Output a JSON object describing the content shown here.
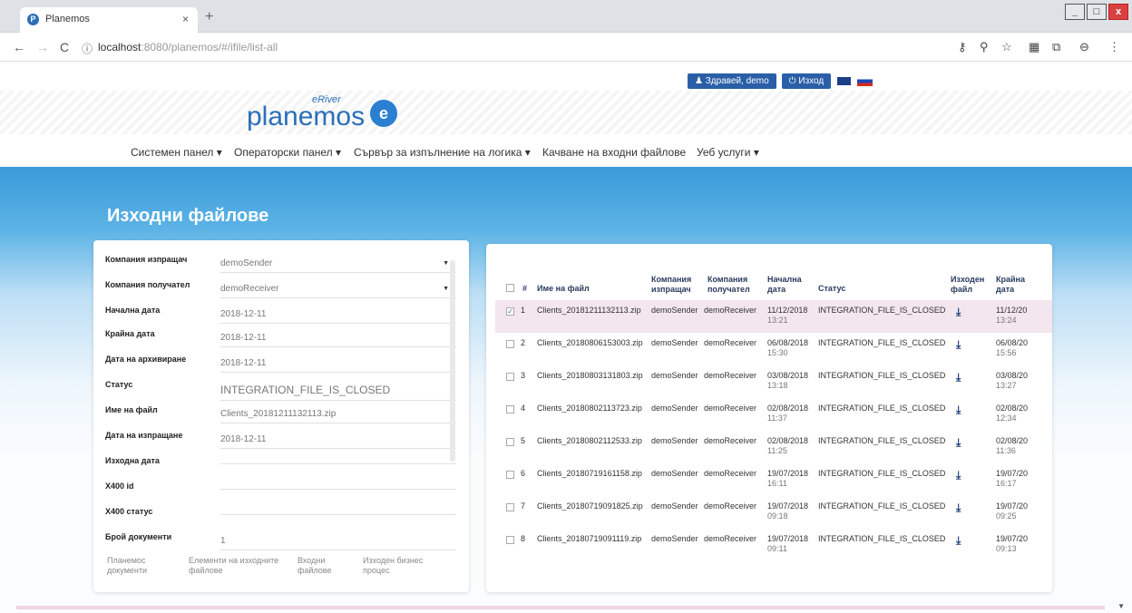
{
  "browser": {
    "tab_title": "Planemos",
    "tab_close": "×",
    "new_tab": "+",
    "favicon": "P",
    "url_host": "localhost",
    "url_rest": ":8080/planemos/#/ifile/list-all",
    "win_min": "_",
    "win_max": "□",
    "win_close": "x",
    "back": "←",
    "forward": "→",
    "reload": "C",
    "info": "ⓘ",
    "key": "⚷",
    "zoom": "⚲",
    "star": "☆",
    "ext": "▦",
    "cast": "⧉",
    "profile": "⊖",
    "more": "⋮"
  },
  "header": {
    "greeting": "Здравей, demo",
    "logout": "Изход",
    "user_glyph": "♟",
    "power_glyph": "⏻"
  },
  "logo": {
    "small": "eRiver",
    "main": "planemos",
    "mark": "e"
  },
  "menu": [
    {
      "label": "Системен панел ▾"
    },
    {
      "label": "Операторски панел ▾"
    },
    {
      "label": "Сървър за изпълнение на логика ▾"
    },
    {
      "label": "Качване на входни файлове"
    },
    {
      "label": "Уеб услуги ▾"
    }
  ],
  "page_title": "Изходни файлове",
  "filters": [
    {
      "label": "Компания изпращач",
      "value": "demoSender"
    },
    {
      "label": "Компания получател",
      "value": "demoReceiver"
    },
    {
      "label": "Начална дата",
      "value": "2018-12-11"
    },
    {
      "label": "Крайна дата",
      "value": "2018-12-11"
    },
    {
      "label": "Дата на архивиране",
      "value": "2018-12-11"
    },
    {
      "label": "Статус",
      "value": "INTEGRATION_FILE_IS_CLOSED"
    },
    {
      "label": "Име на файл",
      "value": "Clients_20181211132113.zip"
    },
    {
      "label": "Дата на изпращане",
      "value": "2018-12-11"
    },
    {
      "label": "Изходна дата",
      "value": ""
    },
    {
      "label": "X400 id",
      "value": ""
    },
    {
      "label": "X400 статус",
      "value": ""
    },
    {
      "label": "Брой документи",
      "value": "1"
    }
  ],
  "left_tabs": [
    {
      "label": "Планемос документи"
    },
    {
      "label": "Елементи на изходните файлове"
    },
    {
      "label": "Входни файлове"
    },
    {
      "label": "Изходен бизнес процес"
    }
  ],
  "table": {
    "headers": {
      "num": "#",
      "name": "Име на файл",
      "sender": "Компания изпращач",
      "receiver": "Компания получател",
      "start": "Начална дата",
      "status": "Статус",
      "outfile": "Изходен файл",
      "end": "Крайна дата"
    },
    "rows": [
      {
        "num": "1",
        "name": "Clients_20181211132113.zip",
        "sender": "demoSender",
        "receiver": "demoReceiver",
        "start_d": "11/12/2018",
        "start_t": "13:21",
        "status": "INTEGRATION_FILE_IS_CLOSED",
        "end_d": "11/12/20",
        "end_t": "13:24",
        "check": "✓"
      },
      {
        "num": "2",
        "name": "Clients_20180806153003.zip",
        "sender": "demoSender",
        "receiver": "demoReceiver",
        "start_d": "06/08/2018",
        "start_t": "15:30",
        "status": "INTEGRATION_FILE_IS_CLOSED",
        "end_d": "06/08/20",
        "end_t": "15:56",
        "check": ""
      },
      {
        "num": "3",
        "name": "Clients_20180803131803.zip",
        "sender": "demoSender",
        "receiver": "demoReceiver",
        "start_d": "03/08/2018",
        "start_t": "13:18",
        "status": "INTEGRATION_FILE_IS_CLOSED",
        "end_d": "03/08/20",
        "end_t": "13:27",
        "check": ""
      },
      {
        "num": "4",
        "name": "Clients_20180802113723.zip",
        "sender": "demoSender",
        "receiver": "demoReceiver",
        "start_d": "02/08/2018",
        "start_t": "11:37",
        "status": "INTEGRATION_FILE_IS_CLOSED",
        "end_d": "02/08/20",
        "end_t": "12:34",
        "check": ""
      },
      {
        "num": "5",
        "name": "Clients_20180802112533.zip",
        "sender": "demoSender",
        "receiver": "demoReceiver",
        "start_d": "02/08/2018",
        "start_t": "11:25",
        "status": "INTEGRATION_FILE_IS_CLOSED",
        "end_d": "02/08/20",
        "end_t": "11:36",
        "check": ""
      },
      {
        "num": "6",
        "name": "Clients_20180719161158.zip",
        "sender": "demoSender",
        "receiver": "demoReceiver",
        "start_d": "19/07/2018",
        "start_t": "16:11",
        "status": "INTEGRATION_FILE_IS_CLOSED",
        "end_d": "19/07/20",
        "end_t": "16:17",
        "check": ""
      },
      {
        "num": "7",
        "name": "Clients_20180719091825.zip",
        "sender": "demoSender",
        "receiver": "demoReceiver",
        "start_d": "19/07/2018",
        "start_t": "09:18",
        "status": "INTEGRATION_FILE_IS_CLOSED",
        "end_d": "19/07/20",
        "end_t": "09:25",
        "check": ""
      },
      {
        "num": "8",
        "name": "Clients_20180719091119.zip",
        "sender": "demoSender",
        "receiver": "demoReceiver",
        "start_d": "19/07/2018",
        "start_t": "09:11",
        "status": "INTEGRATION_FILE_IS_CLOSED",
        "end_d": "19/07/20",
        "end_t": "09:13",
        "check": ""
      }
    ]
  },
  "colors": {
    "hero": "#3a9ad8",
    "brand": "#2a6fb8",
    "selected_row": "#f3e6ef"
  }
}
